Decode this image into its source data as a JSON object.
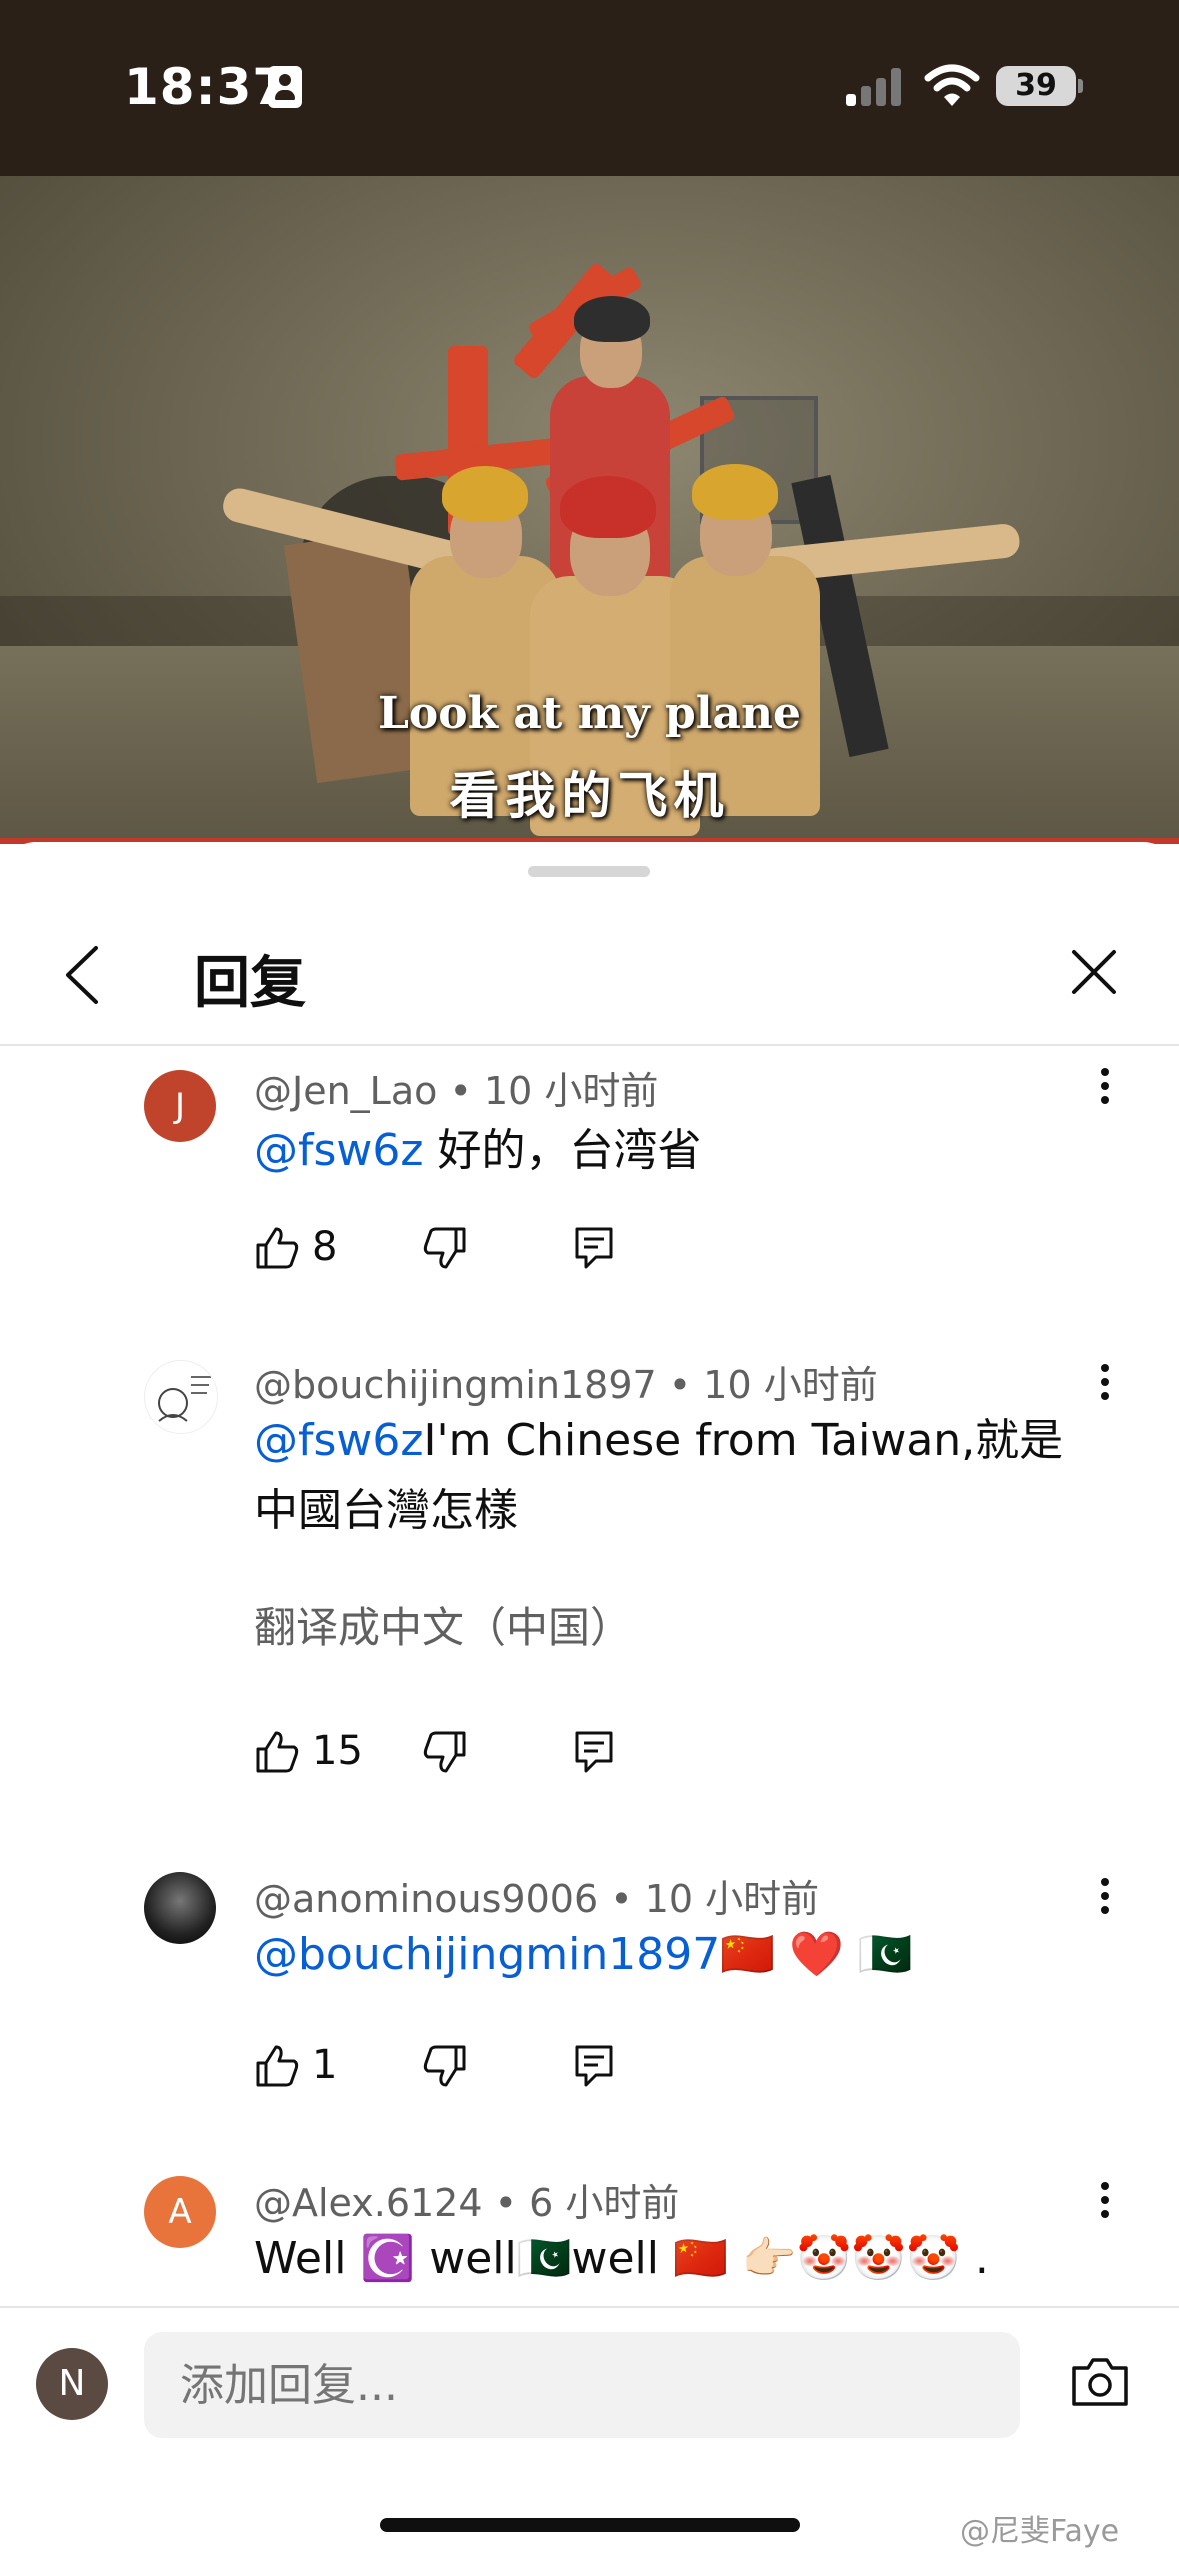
{
  "status_bar": {
    "time": "18:37",
    "battery": "39"
  },
  "video": {
    "subtitle_en": "Look at my plane",
    "subtitle_zh": "看我的飞机"
  },
  "header": {
    "title": "回复"
  },
  "comments": [
    {
      "author": "@Jen_Lao",
      "time": "10 小时前",
      "avatar_letter": "J",
      "avatar_color": "#c0442c",
      "mention": "@fsw6z",
      "text": " 好的，台湾省",
      "likes": "8"
    },
    {
      "author": "@bouchijingmin1897",
      "time": "10 小时前",
      "mention": "@fsw6z",
      "text": "I'm Chinese from Taiwan,就是中國台灣怎樣",
      "translate": "翻译成中文（中国）",
      "likes": "15"
    },
    {
      "author": "@anominous9006",
      "time": "10 小时前",
      "mention": "@bouchijingmin1897",
      "text": "🇨🇳 ❤️ 🇵🇰",
      "likes": "1"
    },
    {
      "author": "@Alex.6124",
      "time": "6 小时前",
      "avatar_letter": "A",
      "avatar_color": "#e8743b",
      "text": "Well ☪️ well🇵🇰well 🇨🇳 👉🏻🤡🤡🤡 ."
    }
  ],
  "composer": {
    "avatar_letter": "N",
    "placeholder": "添加回复..."
  },
  "watermark": "@尼斐Faye"
}
